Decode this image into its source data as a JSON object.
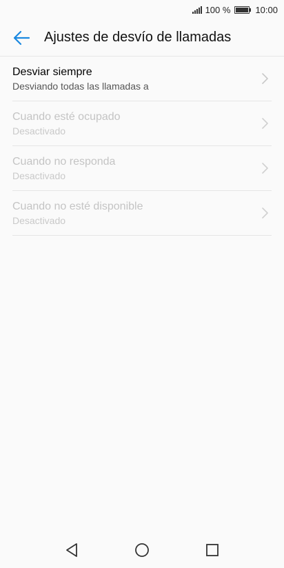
{
  "status_bar": {
    "battery_percent": "100 %",
    "time": "10:00",
    "battery_level": 1.0
  },
  "header": {
    "title": "Ajustes de desvío de llamadas",
    "back_icon": "back-arrow-icon",
    "accent_color": "#1a88e0"
  },
  "items": [
    {
      "title": "Desviar siempre",
      "subtitle": "Desviando todas las llamadas a",
      "enabled": true
    },
    {
      "title": "Cuando esté ocupado",
      "subtitle": "Desactivado",
      "enabled": false
    },
    {
      "title": "Cuando no responda",
      "subtitle": "Desactivado",
      "enabled": false
    },
    {
      "title": "Cuando no esté disponible",
      "subtitle": "Desactivado",
      "enabled": false
    }
  ],
  "nav_bar": {
    "icons": [
      "back-triangle-icon",
      "home-circle-icon",
      "recents-square-icon"
    ]
  }
}
